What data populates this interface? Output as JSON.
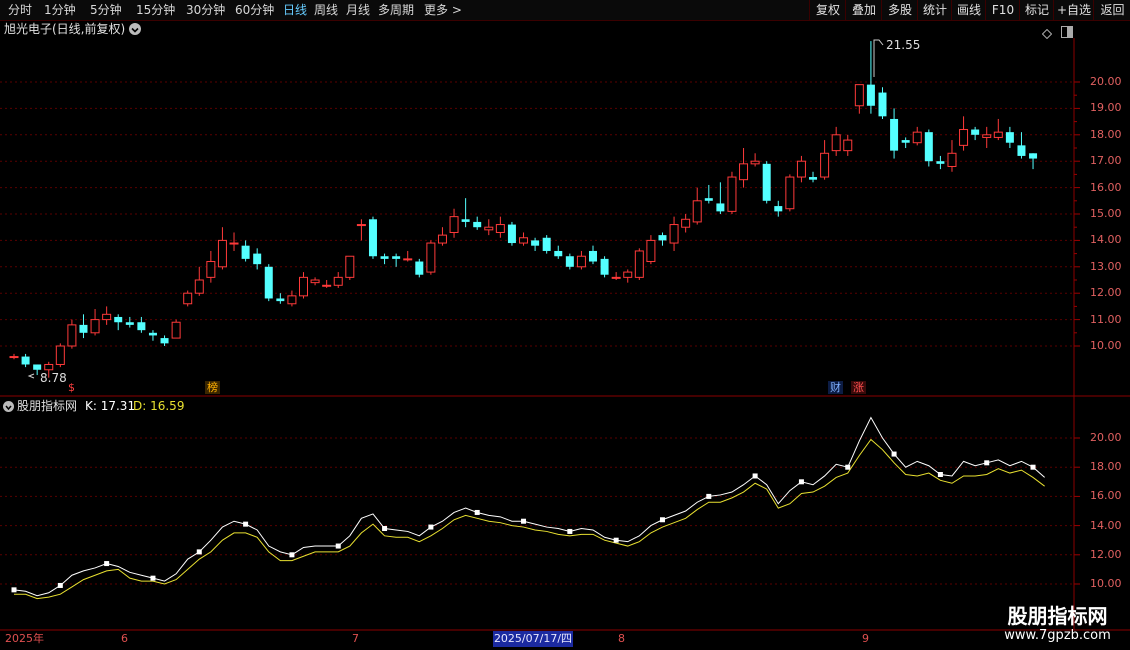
{
  "toolbar": {
    "periods": [
      {
        "label": "分时",
        "active": false
      },
      {
        "label": "1分钟",
        "active": false
      },
      {
        "label": "5分钟",
        "active": false
      },
      {
        "label": "15分钟",
        "active": false
      },
      {
        "label": "30分钟",
        "active": false
      },
      {
        "label": "60分钟",
        "active": false
      },
      {
        "label": "日线",
        "active": true
      },
      {
        "label": "周线",
        "active": false
      },
      {
        "label": "月线",
        "active": false
      },
      {
        "label": "多周期",
        "active": false
      },
      {
        "label": "更多 >",
        "active": false
      }
    ],
    "buttons": [
      "复权",
      "叠加",
      "多股",
      "统计",
      "画线",
      "F10",
      "+自选",
      "返回"
    ],
    "last_button": "标记"
  },
  "chart": {
    "title": "旭光电子(日线,前复权)",
    "high_label": "21.55",
    "low_label": "8.78",
    "price_ticks": [
      "20.00",
      "19.00",
      "18.00",
      "17.00",
      "16.00",
      "15.00",
      "14.00",
      "13.00",
      "12.00",
      "11.00",
      "10.00"
    ],
    "markers": [
      {
        "text": "$",
        "color": "#ff4040"
      },
      {
        "text": "榜",
        "color": "#ffb000"
      },
      {
        "text": "财",
        "color": "#7fb0ff"
      },
      {
        "text": "涨",
        "color": "#ff5050"
      }
    ]
  },
  "indicator": {
    "name": "股朋指标网",
    "k_label": "K: 17.31",
    "d_label": "D: 16.59",
    "ticks": [
      "20.00",
      "18.00",
      "16.00",
      "14.00",
      "12.00",
      "10.00"
    ],
    "k_color": "#ffffff",
    "d_color": "#e8e030"
  },
  "date_axis": {
    "labels": [
      "2025年",
      "6",
      "7",
      "8",
      "9"
    ],
    "cursor": "2025/07/17/四"
  },
  "watermark": {
    "title": "股朋指标网",
    "url": "www.7gpzb.com"
  },
  "chart_data": {
    "type": "candlestick",
    "ylim": [
      8.5,
      22.0
    ],
    "up_color": "#ff3a3a",
    "down_color": "#54ffff",
    "candles": [
      [
        9.6,
        9.6,
        9.7,
        9.5
      ],
      [
        9.6,
        9.3,
        9.7,
        9.2
      ],
      [
        9.3,
        9.1,
        9.3,
        8.9
      ],
      [
        9.1,
        9.3,
        9.4,
        8.8
      ],
      [
        9.3,
        10.0,
        10.1,
        9.2
      ],
      [
        10.0,
        10.8,
        11.0,
        9.9
      ],
      [
        10.8,
        10.5,
        11.2,
        10.3
      ],
      [
        10.5,
        11.0,
        11.4,
        10.4
      ],
      [
        11.0,
        11.2,
        11.5,
        10.8
      ],
      [
        11.1,
        10.9,
        11.2,
        10.6
      ],
      [
        10.9,
        10.8,
        11.1,
        10.7
      ],
      [
        10.9,
        10.6,
        11.1,
        10.5
      ],
      [
        10.5,
        10.4,
        10.6,
        10.2
      ],
      [
        10.3,
        10.1,
        10.4,
        10.0
      ],
      [
        10.3,
        10.9,
        11.0,
        10.3
      ],
      [
        11.6,
        12.0,
        12.1,
        11.5
      ],
      [
        12.0,
        12.5,
        13.0,
        11.9
      ],
      [
        12.6,
        13.2,
        13.6,
        12.4
      ],
      [
        13.0,
        14.0,
        14.5,
        12.9
      ],
      [
        13.9,
        13.9,
        14.3,
        13.6
      ],
      [
        13.8,
        13.3,
        14.0,
        13.2
      ],
      [
        13.5,
        13.1,
        13.7,
        12.9
      ],
      [
        13.0,
        11.8,
        13.1,
        11.7
      ],
      [
        11.8,
        11.7,
        12.0,
        11.6
      ],
      [
        11.6,
        11.9,
        12.1,
        11.5
      ],
      [
        11.9,
        12.6,
        12.8,
        11.8
      ],
      [
        12.4,
        12.5,
        12.6,
        12.3
      ],
      [
        12.3,
        12.3,
        12.5,
        12.2
      ],
      [
        12.3,
        12.6,
        12.8,
        12.2
      ],
      [
        12.6,
        13.4,
        13.4,
        12.5
      ],
      [
        14.6,
        14.6,
        14.8,
        14.0
      ],
      [
        14.8,
        13.4,
        14.9,
        13.3
      ],
      [
        13.4,
        13.3,
        13.5,
        13.1
      ],
      [
        13.4,
        13.3,
        13.5,
        13.0
      ],
      [
        13.3,
        13.3,
        13.6,
        13.2
      ],
      [
        13.2,
        12.7,
        13.3,
        12.6
      ],
      [
        12.8,
        13.9,
        14.0,
        12.7
      ],
      [
        13.9,
        14.2,
        14.5,
        13.8
      ],
      [
        14.3,
        14.9,
        15.2,
        14.1
      ],
      [
        14.8,
        14.7,
        15.6,
        14.5
      ],
      [
        14.7,
        14.5,
        14.9,
        14.4
      ],
      [
        14.4,
        14.5,
        14.8,
        14.2
      ],
      [
        14.3,
        14.6,
        14.9,
        14.1
      ],
      [
        14.6,
        13.9,
        14.7,
        13.8
      ],
      [
        13.9,
        14.1,
        14.3,
        13.8
      ],
      [
        14.0,
        13.8,
        14.1,
        13.6
      ],
      [
        14.1,
        13.6,
        14.2,
        13.5
      ],
      [
        13.6,
        13.4,
        13.8,
        13.3
      ],
      [
        13.4,
        13.0,
        13.5,
        12.9
      ],
      [
        13.0,
        13.4,
        13.6,
        12.9
      ],
      [
        13.6,
        13.2,
        13.8,
        13.1
      ],
      [
        13.3,
        12.7,
        13.4,
        12.6
      ],
      [
        12.6,
        12.6,
        12.8,
        12.5
      ],
      [
        12.6,
        12.8,
        12.9,
        12.4
      ],
      [
        12.6,
        13.6,
        13.7,
        12.5
      ],
      [
        13.2,
        14.0,
        14.2,
        13.1
      ],
      [
        14.2,
        14.0,
        14.3,
        13.8
      ],
      [
        13.9,
        14.6,
        14.9,
        13.6
      ],
      [
        14.5,
        14.8,
        15.0,
        14.3
      ],
      [
        14.7,
        15.5,
        16.0,
        14.6
      ],
      [
        15.6,
        15.5,
        16.1,
        15.4
      ],
      [
        15.4,
        15.1,
        16.2,
        15.0
      ],
      [
        15.1,
        16.4,
        16.6,
        15.0
      ],
      [
        16.3,
        16.9,
        17.5,
        16.0
      ],
      [
        16.9,
        17.0,
        17.3,
        16.8
      ],
      [
        16.9,
        15.5,
        17.0,
        15.4
      ],
      [
        15.3,
        15.1,
        15.5,
        14.9
      ],
      [
        15.2,
        16.4,
        16.5,
        15.1
      ],
      [
        16.4,
        17.0,
        17.2,
        16.2
      ],
      [
        16.4,
        16.3,
        16.6,
        16.2
      ],
      [
        16.4,
        17.3,
        17.8,
        16.3
      ],
      [
        17.4,
        18.0,
        18.3,
        17.2
      ],
      [
        17.4,
        17.8,
        18.0,
        17.2
      ],
      [
        19.1,
        19.9,
        19.9,
        18.8
      ],
      [
        19.9,
        19.1,
        21.55,
        18.8
      ],
      [
        19.6,
        18.7,
        19.8,
        18.6
      ],
      [
        18.6,
        17.4,
        19.0,
        17.1
      ],
      [
        17.8,
        17.7,
        17.9,
        17.5
      ],
      [
        17.7,
        18.1,
        18.3,
        17.6
      ],
      [
        18.1,
        17.0,
        18.2,
        16.8
      ],
      [
        17.0,
        16.9,
        17.2,
        16.7
      ],
      [
        16.8,
        17.3,
        17.8,
        16.6
      ],
      [
        17.6,
        18.2,
        18.7,
        17.4
      ],
      [
        18.2,
        18.0,
        18.3,
        17.8
      ],
      [
        17.9,
        18.0,
        18.3,
        17.5
      ],
      [
        17.9,
        18.1,
        18.6,
        17.8
      ],
      [
        18.1,
        17.7,
        18.3,
        17.5
      ],
      [
        17.6,
        17.2,
        18.1,
        17.1
      ],
      [
        17.3,
        17.1,
        17.3,
        16.7
      ]
    ],
    "indicator_ylim": [
      9.0,
      23.0
    ],
    "k": [
      9.6,
      9.5,
      9.2,
      9.4,
      9.9,
      10.6,
      10.9,
      11.1,
      11.4,
      11.2,
      10.8,
      10.6,
      10.4,
      10.2,
      10.7,
      11.7,
      12.2,
      13.0,
      13.9,
      14.3,
      14.1,
      13.7,
      12.6,
      12.2,
      12.0,
      12.5,
      12.6,
      12.6,
      12.6,
      13.3,
      14.5,
      14.8,
      13.8,
      13.7,
      13.6,
      13.3,
      13.9,
      14.3,
      14.9,
      15.2,
      14.9,
      14.7,
      14.6,
      14.3,
      14.3,
      14.1,
      13.9,
      13.8,
      13.6,
      13.8,
      13.7,
      13.2,
      13.0,
      12.9,
      13.3,
      14.0,
      14.4,
      14.7,
      15.0,
      15.6,
      16.0,
      16.1,
      16.3,
      16.8,
      17.4,
      16.8,
      15.5,
      16.4,
      17.0,
      16.8,
      17.4,
      18.2,
      18.0,
      19.8,
      21.4,
      20.0,
      18.9,
      18.0,
      18.4,
      18.1,
      17.5,
      17.4,
      18.4,
      18.1,
      18.3,
      18.5,
      18.1,
      18.4,
      18.0,
      17.3
    ],
    "d": [
      9.3,
      9.3,
      9.0,
      9.1,
      9.3,
      9.8,
      10.3,
      10.6,
      10.9,
      11.0,
      10.4,
      10.2,
      10.2,
      10.0,
      10.3,
      11.0,
      11.7,
      12.2,
      13.0,
      13.5,
      13.5,
      13.2,
      12.2,
      11.6,
      11.6,
      11.9,
      12.2,
      12.2,
      12.2,
      12.6,
      13.5,
      14.1,
      13.3,
      13.2,
      13.2,
      12.9,
      13.3,
      13.8,
      14.4,
      14.7,
      14.5,
      14.3,
      14.2,
      14.0,
      13.9,
      13.7,
      13.6,
      13.4,
      13.3,
      13.4,
      13.4,
      13.0,
      12.8,
      12.6,
      12.9,
      13.5,
      13.9,
      14.2,
      14.5,
      15.1,
      15.6,
      15.6,
      15.9,
      16.3,
      16.9,
      16.5,
      15.2,
      15.5,
      16.2,
      16.3,
      16.7,
      17.3,
      17.6,
      18.8,
      19.9,
      19.2,
      18.3,
      17.5,
      17.4,
      17.6,
      17.1,
      16.9,
      17.4,
      17.4,
      17.5,
      17.9,
      17.6,
      17.8,
      17.3,
      16.7
    ]
  }
}
